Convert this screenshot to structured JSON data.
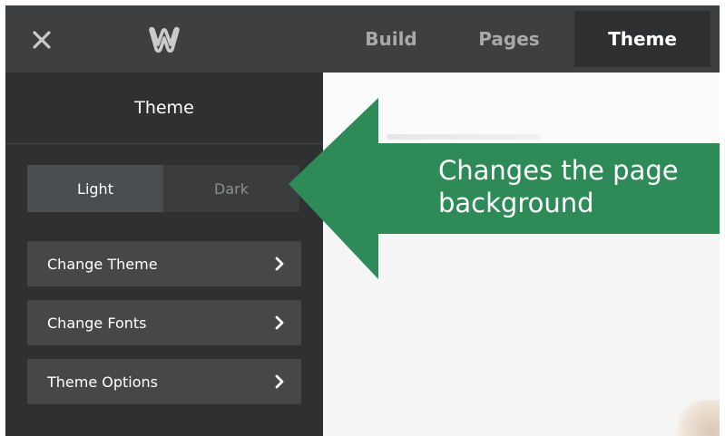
{
  "topbar": {
    "close_icon": "close-icon",
    "logo_icon": "weebly-logo-icon",
    "tabs": [
      {
        "label": "Build",
        "active": false
      },
      {
        "label": "Pages",
        "active": false
      },
      {
        "label": "Theme",
        "active": true
      }
    ]
  },
  "sidebar": {
    "title": "Theme",
    "toggle": {
      "light_label": "Light",
      "dark_label": "Dark",
      "selected": "Light"
    },
    "items": [
      {
        "label": "Change Theme",
        "icon": "chevron-right-icon"
      },
      {
        "label": "Change Fonts",
        "icon": "chevron-right-icon"
      },
      {
        "label": "Theme Options",
        "icon": "chevron-right-icon"
      }
    ]
  },
  "callout": {
    "text": "Changes the page background",
    "color": "#2e8b57"
  },
  "colors": {
    "topbar_bg": "#3d3f41",
    "sidebar_bg": "#2e3031",
    "menu_item_bg": "#454749",
    "active_tab_bg": "#2d2f30"
  }
}
